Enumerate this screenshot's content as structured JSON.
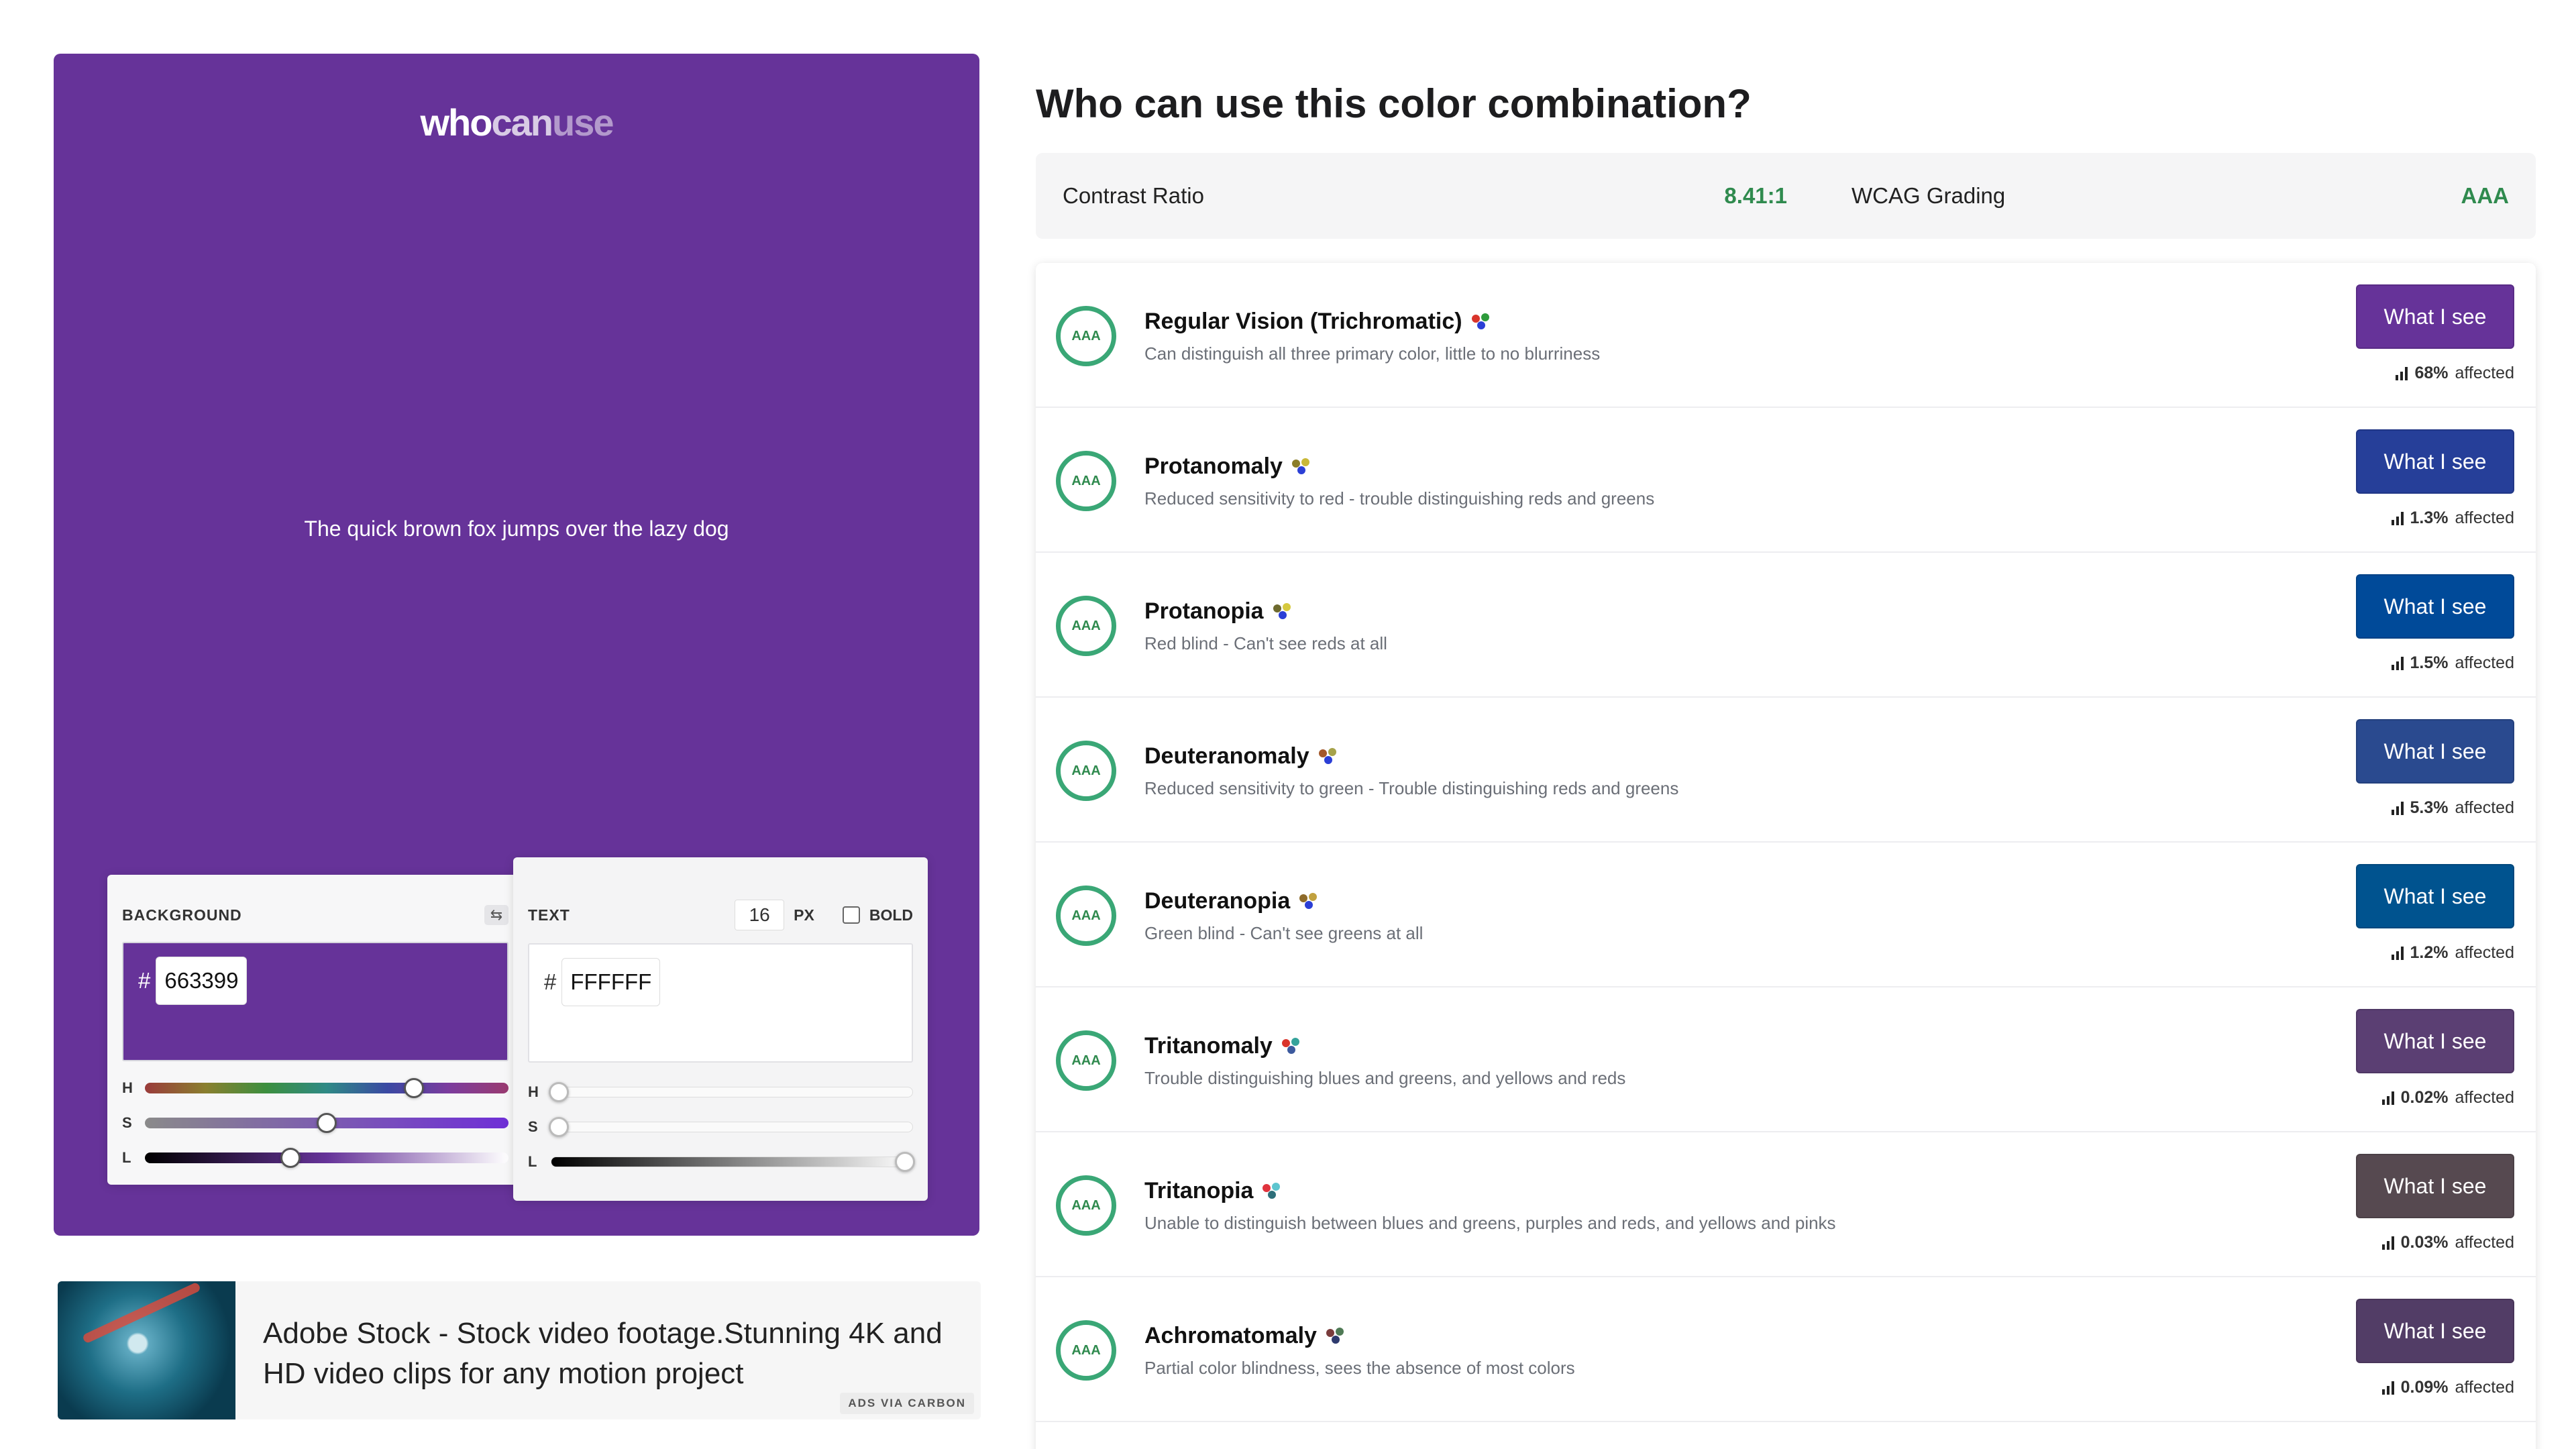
{
  "logo": {
    "part1": "who",
    "part2": "can",
    "part3": "use"
  },
  "preview": {
    "sample_text": "The quick brown fox jumps over the lazy dog",
    "background_color": "#663399",
    "text_color": "#FFFFFF"
  },
  "background_panel": {
    "label": "BACKGROUND",
    "hash": "#",
    "hex": "663399",
    "sliders": {
      "h": "H",
      "s": "S",
      "l": "L"
    },
    "swap_icon": "swap-arrows-icon"
  },
  "text_panel": {
    "label": "TEXT",
    "size": "16",
    "size_unit": "PX",
    "bold_label": "BOLD",
    "hash": "#",
    "hex": "FFFFFF",
    "sliders": {
      "h": "H",
      "s": "S",
      "l": "L"
    }
  },
  "ad": {
    "text": "Adobe Stock - Stock video footage.Stunning 4K and HD video clips for any motion project",
    "via": "ADS VIA CARBON"
  },
  "heading": "Who can use this color combination?",
  "summary": {
    "contrast_label": "Contrast Ratio",
    "contrast_value": "8.41:1",
    "wcag_label": "WCAG Grading",
    "wcag_value": "AAA"
  },
  "rows": [
    {
      "grade": "AAA",
      "title": "Regular Vision (Trichromatic)",
      "desc": "Can distinguish all three primary color, little to no blurriness",
      "button": "What I see",
      "button_color": "#663399",
      "percent": "68%",
      "affected": "affected",
      "dots": [
        "#d9342b",
        "#2e9b3c",
        "#2b3fd6"
      ]
    },
    {
      "grade": "AAA",
      "title": "Protanomaly",
      "desc": "Reduced sensitivity to red - trouble distinguishing reds and greens",
      "button": "What I see",
      "button_color": "#263f99",
      "percent": "1.3%",
      "affected": "affected",
      "dots": [
        "#8a7d2a",
        "#c9b838",
        "#2b3fd6"
      ]
    },
    {
      "grade": "AAA",
      "title": "Protanopia",
      "desc": "Red blind - Can't see reds at all",
      "button": "What I see",
      "button_color": "#004a99",
      "percent": "1.5%",
      "affected": "affected",
      "dots": [
        "#6e6a2e",
        "#d6c93f",
        "#2b3fd6"
      ]
    },
    {
      "grade": "AAA",
      "title": "Deuteranomaly",
      "desc": "Reduced sensitivity to green - Trouble distinguishing reds and greens",
      "button": "What I see",
      "button_color": "#2a4a8f",
      "percent": "5.3%",
      "affected": "affected",
      "dots": [
        "#a3582b",
        "#a6a24a",
        "#2b3fd6"
      ]
    },
    {
      "grade": "AAA",
      "title": "Deuteranopia",
      "desc": "Green blind - Can't see greens at all",
      "button": "What I see",
      "button_color": "#00538f",
      "percent": "1.2%",
      "affected": "affected",
      "dots": [
        "#8e6b2a",
        "#c1a13f",
        "#2b3fd6"
      ]
    },
    {
      "grade": "AAA",
      "title": "Tritanomaly",
      "desc": "Trouble distinguishing blues and greens, and yellows and reds",
      "button": "What I see",
      "button_color": "#5b3f73",
      "percent": "0.02%",
      "affected": "affected",
      "dots": [
        "#d9342b",
        "#35a39b",
        "#3c5a9e"
      ]
    },
    {
      "grade": "AAA",
      "title": "Tritanopia",
      "desc": "Unable to distinguish between blues and greens, purples and reds, and yellows and pinks",
      "button": "What I see",
      "button_color": "#564950",
      "percent": "0.03%",
      "affected": "affected",
      "dots": [
        "#e0333d",
        "#5ec5cf",
        "#2d6f7a"
      ]
    },
    {
      "grade": "AAA",
      "title": "Achromatomaly",
      "desc": "Partial color blindness, sees the absence of most colors",
      "button": "What I see",
      "button_color": "#523d66",
      "percent": "0.09%",
      "affected": "affected",
      "dots": [
        "#7a3c3c",
        "#4f7a55",
        "#2e3a6e"
      ]
    }
  ]
}
